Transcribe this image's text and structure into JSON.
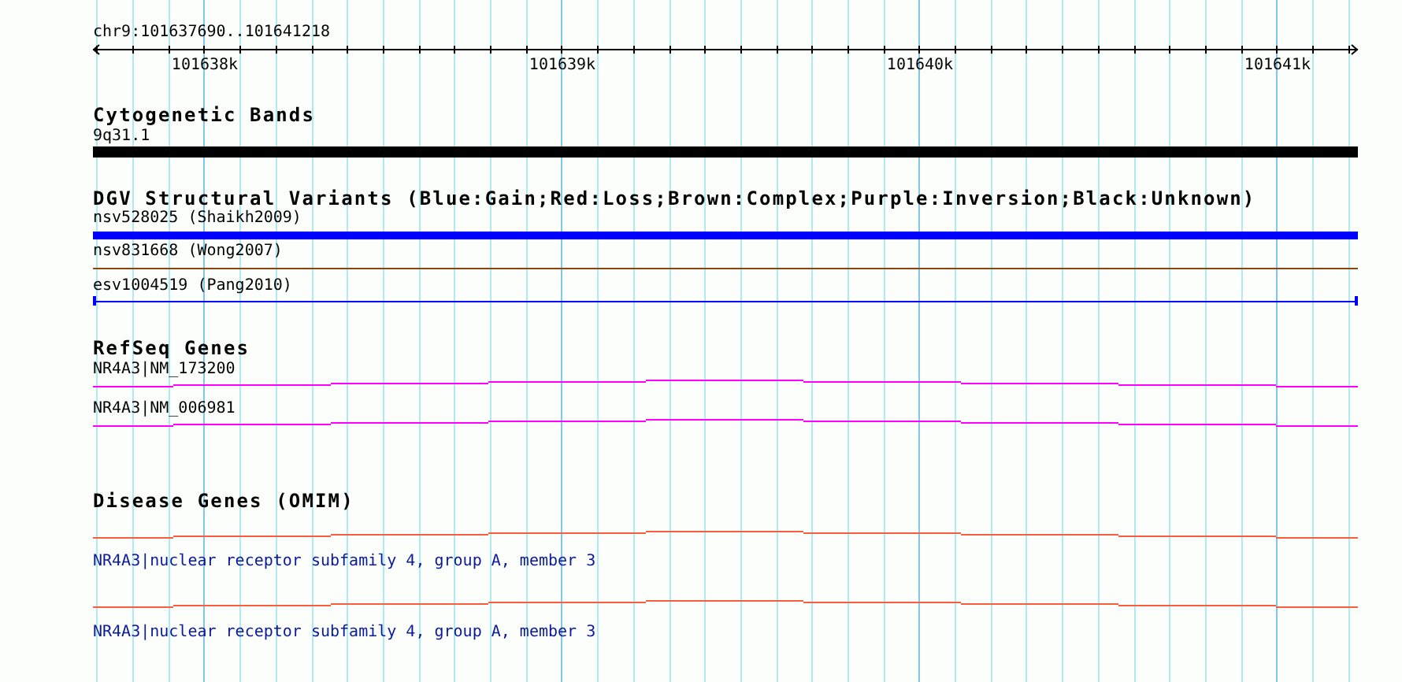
{
  "ruler": {
    "location": "chr9:101637690..101641218",
    "ticks": [
      "101638k",
      "101639k",
      "101640k",
      "101641k"
    ]
  },
  "tracks": [
    {
      "kind": "band",
      "title": "Cytogenetic Bands",
      "features": [
        {
          "kind": "thick",
          "label": "9q31.1",
          "color": "#000000"
        }
      ]
    },
    {
      "kind": "variant",
      "title": "DGV Structural Variants (Blue:Gain;Red:Loss;Brown:Complex;Purple:Inversion;Black:Unknown)",
      "features": [
        {
          "kind": "bar",
          "label": "nsv528025 (Shaikh2009)",
          "color": "#0000ff"
        },
        {
          "kind": "line",
          "label": "nsv831668 (Wong2007)",
          "color": "#8b4513"
        },
        {
          "kind": "capped",
          "label": "esv1004519 (Pang2010)",
          "color": "#0000ff"
        }
      ]
    },
    {
      "kind": "gene",
      "title": "RefSeq Genes",
      "features": [
        {
          "kind": "steps",
          "label": "NR4A3|NM_173200",
          "color": "#ff00ff"
        },
        {
          "kind": "steps",
          "label": "NR4A3|NM_006981",
          "color": "#ff00ff"
        }
      ]
    },
    {
      "kind": "disease",
      "title": "Disease Genes (OMIM)",
      "features": [
        {
          "kind": "steps",
          "label": "NR4A3|nuclear receptor subfamily 4, group A, member 3",
          "color": "#f65e3f"
        },
        {
          "kind": "steps",
          "label": "NR4A3|nuclear receptor subfamily 4, group A, member 3",
          "color": "#f65e3f"
        }
      ]
    }
  ]
}
